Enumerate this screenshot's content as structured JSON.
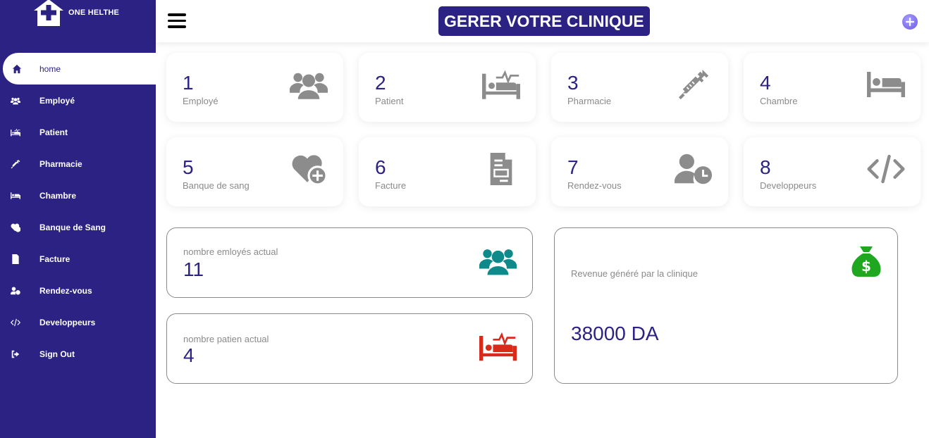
{
  "brand": {
    "name": "ONE HELTHE"
  },
  "header": {
    "title": "GERER VOTRE CLINIQUE",
    "add_icon": "plus-circle-icon"
  },
  "colors": {
    "primary": "#2b2283",
    "teal": "#0e8a8a",
    "red": "#d92b1c",
    "green": "#1fa71f",
    "icon_gray": "#8c8c8c"
  },
  "sidebar": {
    "items": [
      {
        "label": "home",
        "icon": "home-icon"
      },
      {
        "label": "Employé",
        "icon": "users-icon"
      },
      {
        "label": "Patient",
        "icon": "hospital-bed-icon"
      },
      {
        "label": "Pharmacie",
        "icon": "syringe-icon"
      },
      {
        "label": "Chambre",
        "icon": "bed-icon"
      },
      {
        "label": "Banque de Sang",
        "icon": "heart-plus-icon"
      },
      {
        "label": "Facture",
        "icon": "invoice-icon"
      },
      {
        "label": "Rendez-vous",
        "icon": "user-clock-icon"
      },
      {
        "label": "Developpeurs",
        "icon": "code-icon"
      },
      {
        "label": "Sign Out",
        "icon": "sign-out-icon"
      }
    ]
  },
  "cards": [
    {
      "number": "1",
      "label": "Employé",
      "icon": "users-icon"
    },
    {
      "number": "2",
      "label": "Patient",
      "icon": "hospital-bed-icon"
    },
    {
      "number": "3",
      "label": "Pharmacie",
      "icon": "syringe-icon"
    },
    {
      "number": "4",
      "label": "Chambre",
      "icon": "bed-icon"
    },
    {
      "number": "5",
      "label": "Banque de sang",
      "icon": "heart-plus-icon"
    },
    {
      "number": "6",
      "label": "Facture",
      "icon": "invoice-icon"
    },
    {
      "number": "7",
      "label": "Rendez-vous",
      "icon": "user-clock-icon"
    },
    {
      "number": "8",
      "label": "Developpeurs",
      "icon": "code-icon"
    }
  ],
  "stats": {
    "employees": {
      "label": "nombre emloyés actual",
      "value": "11",
      "icon": "users-icon"
    },
    "patients": {
      "label": "nombre patien actual",
      "value": "4",
      "icon": "hospital-bed-icon"
    },
    "revenue": {
      "label": "Revenue généré par la clinique",
      "value": "38000 DA",
      "icon": "money-bag-icon"
    }
  }
}
